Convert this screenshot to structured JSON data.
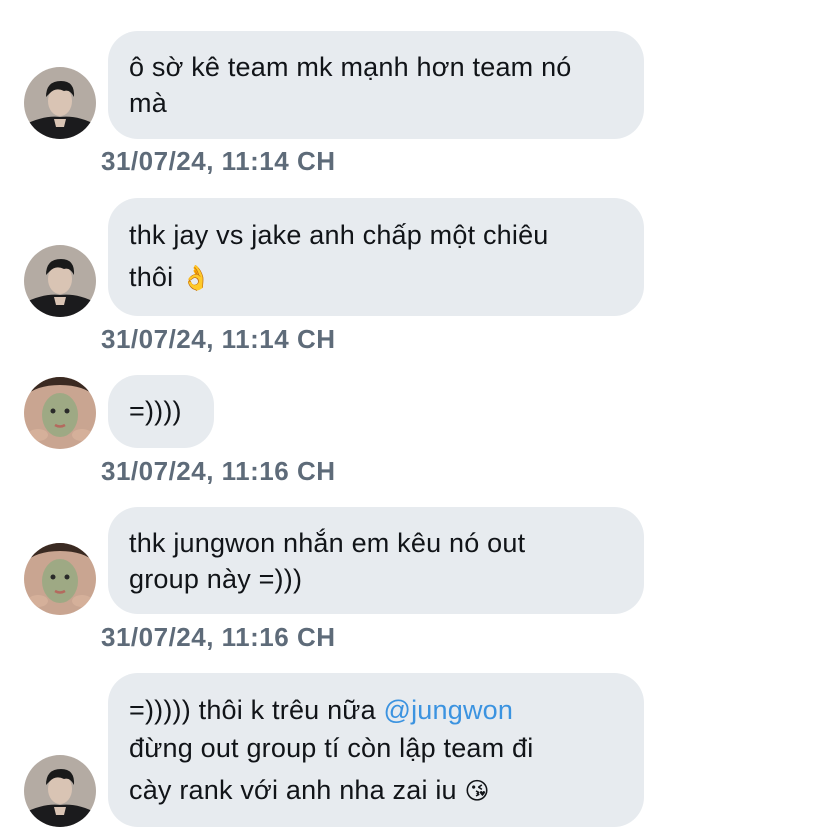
{
  "colors": {
    "bubble": "#e7ebef",
    "text": "#111418",
    "timestamp": "#5e6b79",
    "mention": "#3b93e0"
  },
  "messages": [
    {
      "sender_avatar": "avatar-dark-hair-man",
      "lines": [
        "ô sờ kê team mk mạnh hơn team nó",
        "mà"
      ],
      "timestamp": "31/07/24, 11:14 CH"
    },
    {
      "sender_avatar": "avatar-dark-hair-man",
      "lines": [
        "thk jay vs jake anh chấp một chiêu",
        "thôi"
      ],
      "emoji": "👌",
      "timestamp": "31/07/24, 11:14 CH"
    },
    {
      "sender_avatar": "avatar-face-mask",
      "lines": [
        "=))))"
      ],
      "timestamp": "31/07/24, 11:16 CH"
    },
    {
      "sender_avatar": "avatar-face-mask",
      "lines": [
        "thk jungwon nhắn em kêu nó out",
        "group này =)))"
      ],
      "timestamp": "31/07/24, 11:16 CH"
    },
    {
      "sender_avatar": "avatar-dark-hair-man",
      "line1_prefix": "=))))) thôi k trêu nữa ",
      "mention": "@jungwon",
      "lines_rest": [
        "đừng out group tí còn lập team đi",
        "cày rank với anh nha zai iu"
      ],
      "emoji": "😘"
    }
  ]
}
